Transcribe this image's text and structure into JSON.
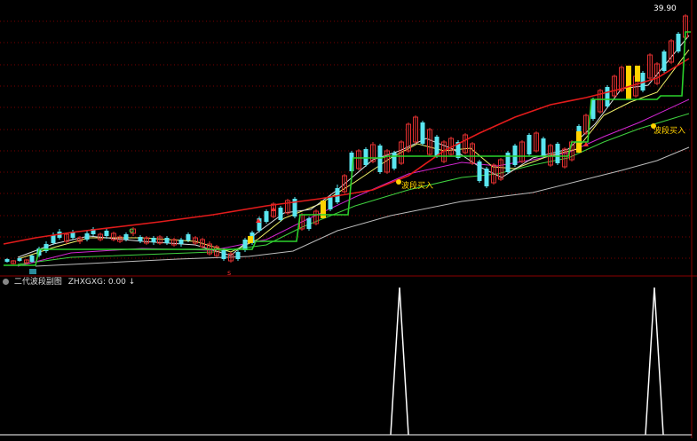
{
  "window": {
    "title": ""
  },
  "main_chart": {
    "price_label": "39.90",
    "annotations": [
      {
        "text": "波段买入"
      },
      {
        "text": "波段买入"
      }
    ],
    "colors": {
      "background": "#000000",
      "frame": "#8b0000",
      "grid": "#7a0000",
      "band_red": "#e21b1b",
      "band_green": "#2bd12b",
      "ma_white": "#d8d8d8",
      "ma_yellow": "#f4f46a",
      "ma_magenta": "#d126d1",
      "ma_green": "#3fd13f",
      "ma_gray": "#bbbbbb",
      "candle_up": "#e23030",
      "candle_down": "#5ae6f0",
      "signal_yellow": "#ffd200"
    }
  },
  "sub_chart": {
    "title": "二代波段副图",
    "indicator": "ZHXGXG: 0.00",
    "arrow": "↓",
    "colors": {
      "spike": "#ffffff"
    }
  }
}
